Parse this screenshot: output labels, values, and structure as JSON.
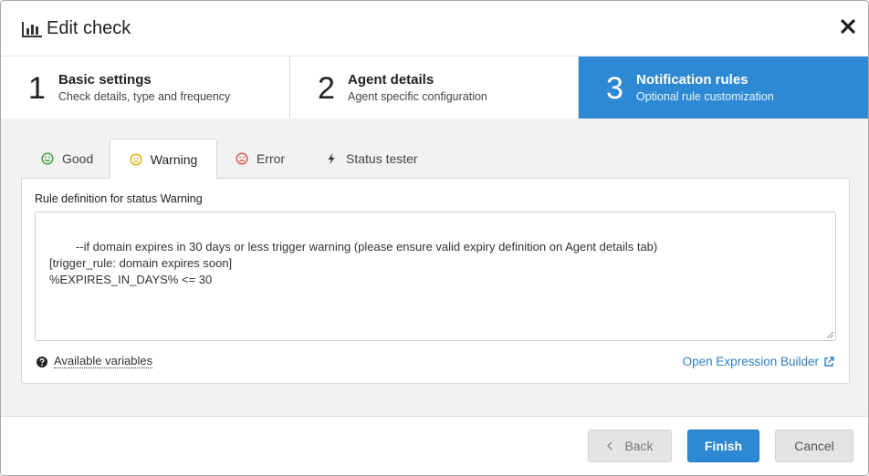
{
  "dialog": {
    "title": "Edit check",
    "title_icon": "bar-chart-icon",
    "close_icon": "close-icon"
  },
  "steps": [
    {
      "number": "1",
      "title": "Basic settings",
      "subtitle": "Check details, type and frequency",
      "active": false
    },
    {
      "number": "2",
      "title": "Agent details",
      "subtitle": "Agent specific configuration",
      "active": false
    },
    {
      "number": "3",
      "title": "Notification rules",
      "subtitle": "Optional rule customization",
      "active": true
    }
  ],
  "tabs": [
    {
      "label": "Good",
      "icon": "smile-icon",
      "color": "#3a9a3a"
    },
    {
      "label": "Warning",
      "icon": "neutral-face-icon",
      "color": "#e0a800",
      "active": true
    },
    {
      "label": "Error",
      "icon": "frown-icon",
      "color": "#d9534f"
    },
    {
      "label": "Status tester",
      "icon": "bolt-icon",
      "color": "#333333"
    }
  ],
  "panel": {
    "label": "Rule definition for status Warning",
    "rule_text": "--if domain expires in 30 days or less trigger warning (please ensure valid expiry definition on Agent details tab)\n[trigger_rule: domain expires soon]\n%EXPIRES_IN_DAYS% <= 30",
    "available_variables": "Available variables",
    "open_builder": "Open Expression Builder"
  },
  "footer": {
    "back": "Back",
    "finish": "Finish",
    "cancel": "Cancel"
  },
  "colors": {
    "accent": "#2d89d3",
    "link": "#2d7fc1"
  }
}
